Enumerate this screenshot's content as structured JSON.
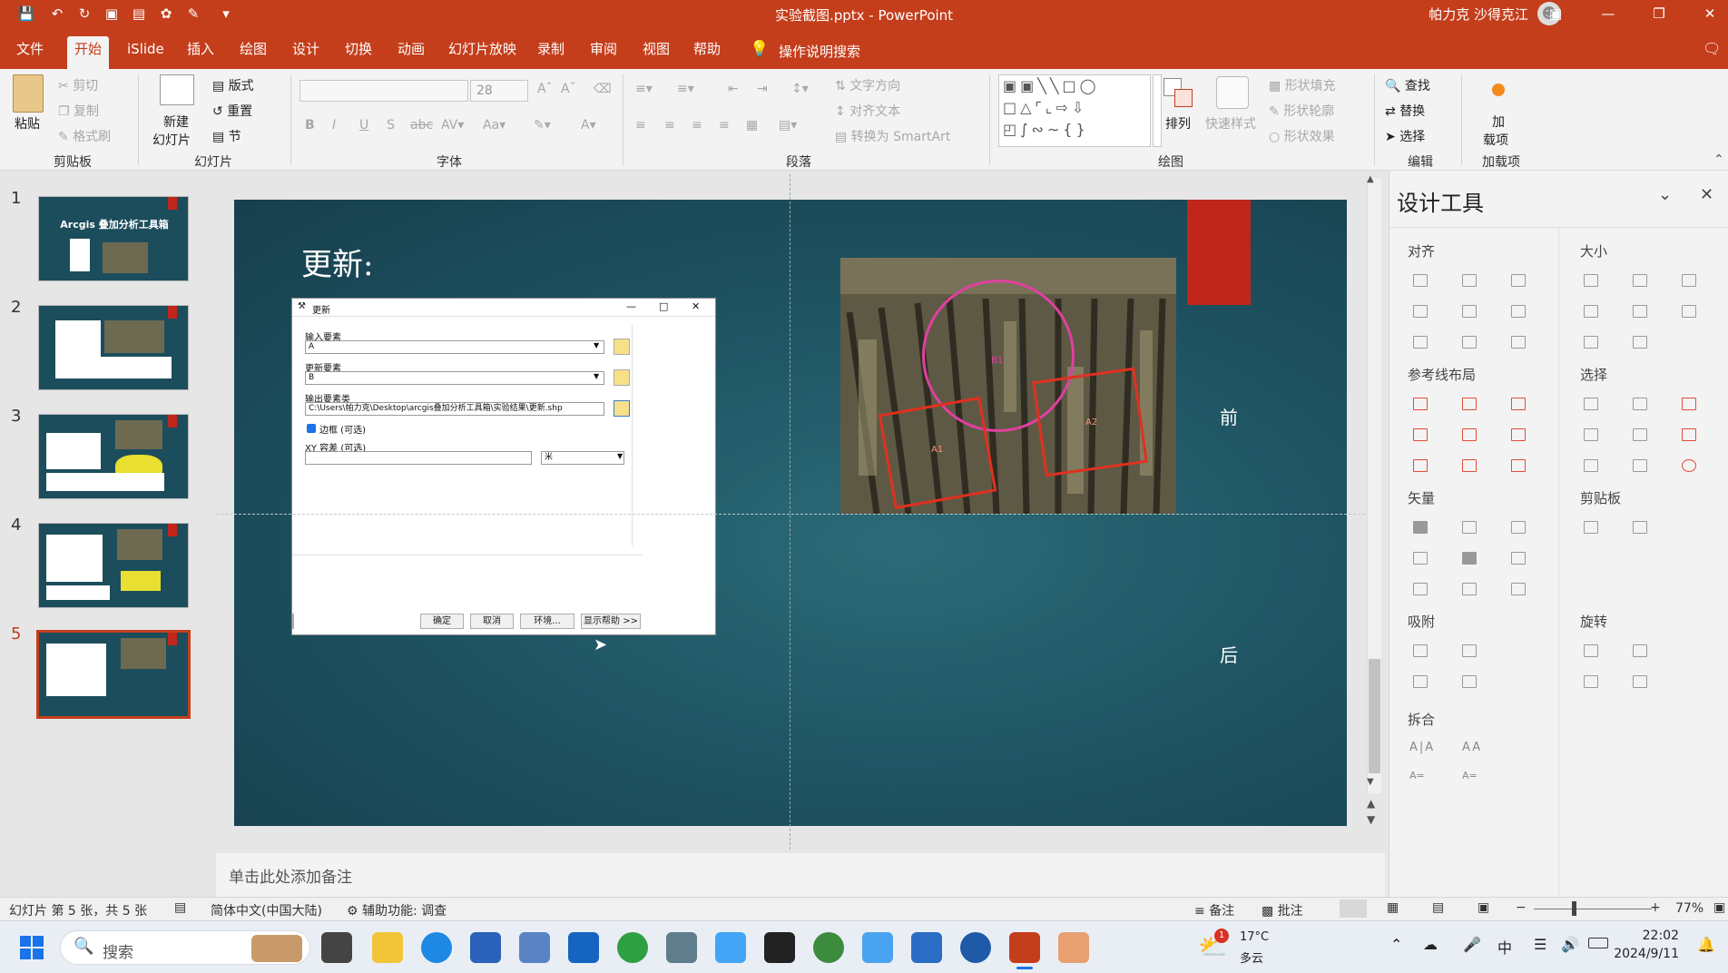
{
  "app": {
    "title": "实验截图.pptx - PowerPoint",
    "user": "帕力克 沙得克江",
    "accent": "#c43e1c"
  },
  "menu_tabs": [
    "文件",
    "开始",
    "iSlide",
    "插入",
    "绘图",
    "设计",
    "切换",
    "动画",
    "幻灯片放映",
    "录制",
    "审阅",
    "视图",
    "帮助"
  ],
  "tell_me": "操作说明搜索",
  "ribbon": {
    "clipboard": {
      "paste": "粘贴",
      "cut": "剪切",
      "copy": "复制",
      "format_painter": "格式刷",
      "label": "剪贴板"
    },
    "slides": {
      "new_slide": "新建",
      "new_slide2": "幻灯片",
      "layout": "版式",
      "reset": "重置",
      "section": "节",
      "label": "幻灯片"
    },
    "font": {
      "size": "28",
      "label": "字体"
    },
    "paragraph": {
      "text_direction": "文字方向",
      "align_text": "对齐文本",
      "smartart": "转换为 SmartArt",
      "label": "段落"
    },
    "drawing": {
      "arrange": "排列",
      "quick_styles": "快速样式",
      "shape_fill": "形状填充",
      "shape_outline": "形状轮廓",
      "shape_effects": "形状效果",
      "label": "绘图"
    },
    "editing": {
      "find": "查找",
      "replace": "替换",
      "select": "选择",
      "label": "编辑"
    },
    "addins": {
      "addins": "加",
      "addins2": "载项",
      "label": "加载项"
    }
  },
  "thumbnails": [
    {
      "num": "1",
      "title": "Arcgis 叠加分析工具箱"
    },
    {
      "num": "2",
      "title": ""
    },
    {
      "num": "3",
      "title": ""
    },
    {
      "num": "4",
      "title": ""
    },
    {
      "num": "5",
      "title": ""
    }
  ],
  "selected_slide": "5",
  "slide": {
    "title": "更新:",
    "label_before": "前",
    "label_after": "后",
    "map_labels": {
      "b1": "B1",
      "a1": "A1",
      "a2": "A2"
    }
  },
  "dialog": {
    "title": "更新",
    "input_label": "输入要素",
    "input_value": "A",
    "update_label": "更新要素",
    "update_value": "B",
    "output_label": "输出要素类",
    "output_value": "C:\\Users\\帕力克\\Desktop\\arcgis叠加分析工具箱\\实验结果\\更新.shp",
    "borders_label": "边框 (可选)",
    "tolerance_label": "XY 容差 (可选)",
    "unit_value": "米",
    "ok": "确定",
    "cancel": "取消",
    "env": "环境...",
    "help": "显示帮助 >>"
  },
  "notes_placeholder": "单击此处添加备注",
  "panel": {
    "title": "设计工具",
    "sections": {
      "align": "对齐",
      "size": "大小",
      "guides": "参考线布局",
      "select": "选择",
      "vector": "矢量",
      "clipboard": "剪贴板",
      "snap": "吸附",
      "rotate": "旋转",
      "split": "拆合"
    }
  },
  "status": {
    "slide_info": "幻灯片 第 5 张，共 5 张",
    "language": "简体中文(中国大陆)",
    "accessibility": "辅助功能: 调查",
    "notes": "备注",
    "comments": "批注",
    "zoom": "77%"
  },
  "taskbar": {
    "search": "搜索",
    "weather_temp": "17°C",
    "weather_desc": "多云",
    "weather_badge": "1",
    "ime": "中",
    "time": "22:02",
    "date": "2024/9/11"
  }
}
